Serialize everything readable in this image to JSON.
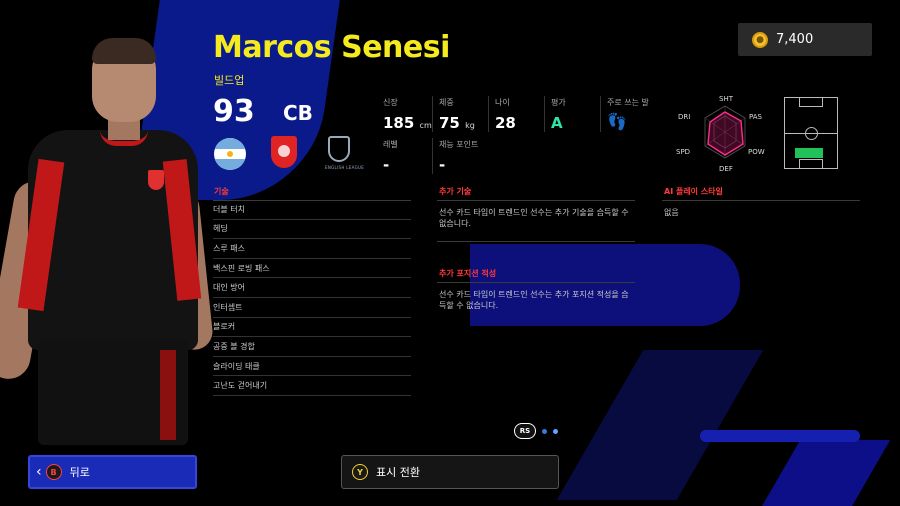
{
  "player": {
    "name": "Marcos Senesi",
    "playstyle": "빌드업",
    "rating": "93",
    "position": "CB"
  },
  "badges": {
    "nationality_icon": "argentina-flag-icon",
    "club_icon": "club-crest-icon",
    "league_icon": "english-league-icon",
    "league_text": "ENGLISH LEAGUE"
  },
  "stats": {
    "height": {
      "label": "신장",
      "value": "185",
      "unit": "cm"
    },
    "weight": {
      "label": "체중",
      "value": "75",
      "unit": "kg"
    },
    "age": {
      "label": "나이",
      "value": "28"
    },
    "grade": {
      "label": "평가",
      "value": "A"
    },
    "foot": {
      "label": "주로 쓰는 발",
      "icon": "footprints-icon"
    },
    "level": {
      "label": "레벨",
      "value": "-"
    },
    "skill_points": {
      "label": "재능 포인트",
      "value": "-"
    }
  },
  "radar": {
    "labels": {
      "sht": "SHT",
      "pas": "PAS",
      "pow": "POW",
      "def": "DEF",
      "spd": "SPD",
      "dri": "DRI"
    }
  },
  "currency": {
    "icon": "coin-icon",
    "value": "7,400"
  },
  "sections": {
    "skills_title": "기술",
    "skills": [
      "더블 터치",
      "헤딩",
      "스루 패스",
      "백스핀 로빙 패스",
      "대인 방어",
      "인터셉트",
      "블로커",
      "공중 볼 경합",
      "슬라이딩 태클",
      "고난도 걷어내기"
    ],
    "extra_skills_title": "추가 기술",
    "extra_skills_desc": "선수 카드 타입이 트렌드인 선수는 추가 기술을 습득할 수 없습니다.",
    "extra_positions_title": "추가 포지션 적성",
    "extra_positions_desc": "선수 카드 타입이 트렌드인 선수는 추가 포지션 적성을 습득할 수 없습니다.",
    "ai_style_title": "AI 플레이 스타일",
    "ai_style_value": "없음"
  },
  "pager": {
    "button": "RS"
  },
  "footer": {
    "back_glyph": "B",
    "back_label": "뒤로",
    "toggle_glyph": "Y",
    "toggle_label": "표시 전환"
  },
  "colors": {
    "accent_yellow": "#f5ea1e",
    "section_red": "#ff3a3a",
    "grade_green": "#2ee6a6",
    "back_blue": "#1a2bb8"
  }
}
